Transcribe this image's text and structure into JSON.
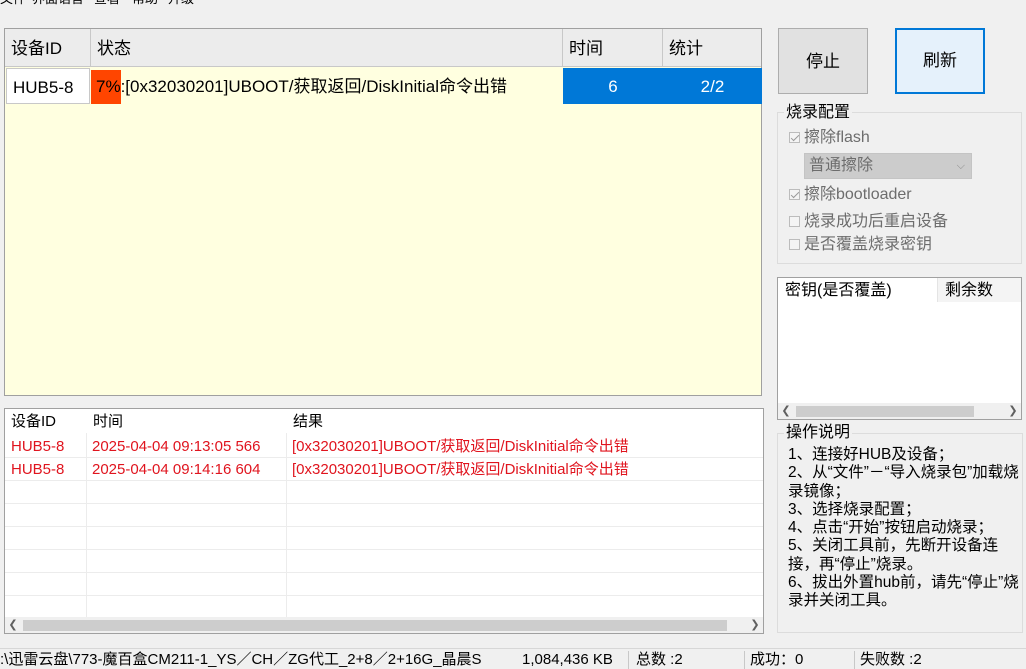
{
  "menu": [
    "文件",
    "界面语言",
    "查看",
    "帮助",
    "升级"
  ],
  "device_table": {
    "columns": [
      "设备ID",
      "状态",
      "时间",
      "统计"
    ],
    "rows": [
      {
        "device_id": "HUB5-8",
        "progress_label": "7%",
        "progress": 0.07,
        "status": ":[0x32030201]UBOOT/获取返回/DiskInitial命令出错",
        "time": "6",
        "stat": "2/2"
      }
    ]
  },
  "log": {
    "columns": [
      "设备ID",
      "时间",
      "结果"
    ],
    "rows": [
      {
        "device_id": "HUB5-8",
        "time": "2025-04-04 09:13:05 566",
        "result": "[0x32030201]UBOOT/获取返回/DiskInitial命令出错"
      },
      {
        "device_id": "HUB5-8",
        "time": "2025-04-04 09:14:16 604",
        "result": "[0x32030201]UBOOT/获取返回/DiskInitial命令出错"
      }
    ]
  },
  "buttons": {
    "stop": "停止",
    "refresh": "刷新"
  },
  "burn_config": {
    "title": "烧录配置",
    "erase_flash": "擦除flash",
    "erase_mode": "普通擦除",
    "erase_bootloader": "擦除bootloader",
    "reboot_after": "烧录成功后重启设备",
    "overwrite_key": "是否覆盖烧录密钥"
  },
  "key_table": {
    "columns": [
      "密钥(是否覆盖)",
      "剩余数"
    ]
  },
  "instructions": {
    "title": "操作说明",
    "text": "1、连接好HUB及设备；\n2、从“文件”－“导入烧录包”加载烧录镜像；\n3、选择烧录配置；\n4、点击“开始”按钮启动烧录；\n5、关闭工具前，先断开设备连接，再“停止”烧录。\n6、拔出外置hub前，请先“停止”烧录并关闭工具。"
  },
  "statusbar": {
    "path": ":\\迅雷云盘\\773-魔百盒CM211-1_YS／CH／ZG代工_2+8／2+16G_晶晨S",
    "size": "1,084,436 KB",
    "total": "总数 :2",
    "success": "成功：0",
    "fail": "失败数 :2"
  },
  "colors": {
    "accent": "#0078d7",
    "progress": "#ff4500",
    "error": "#e0141e",
    "table_bg": "#ffffe0"
  }
}
